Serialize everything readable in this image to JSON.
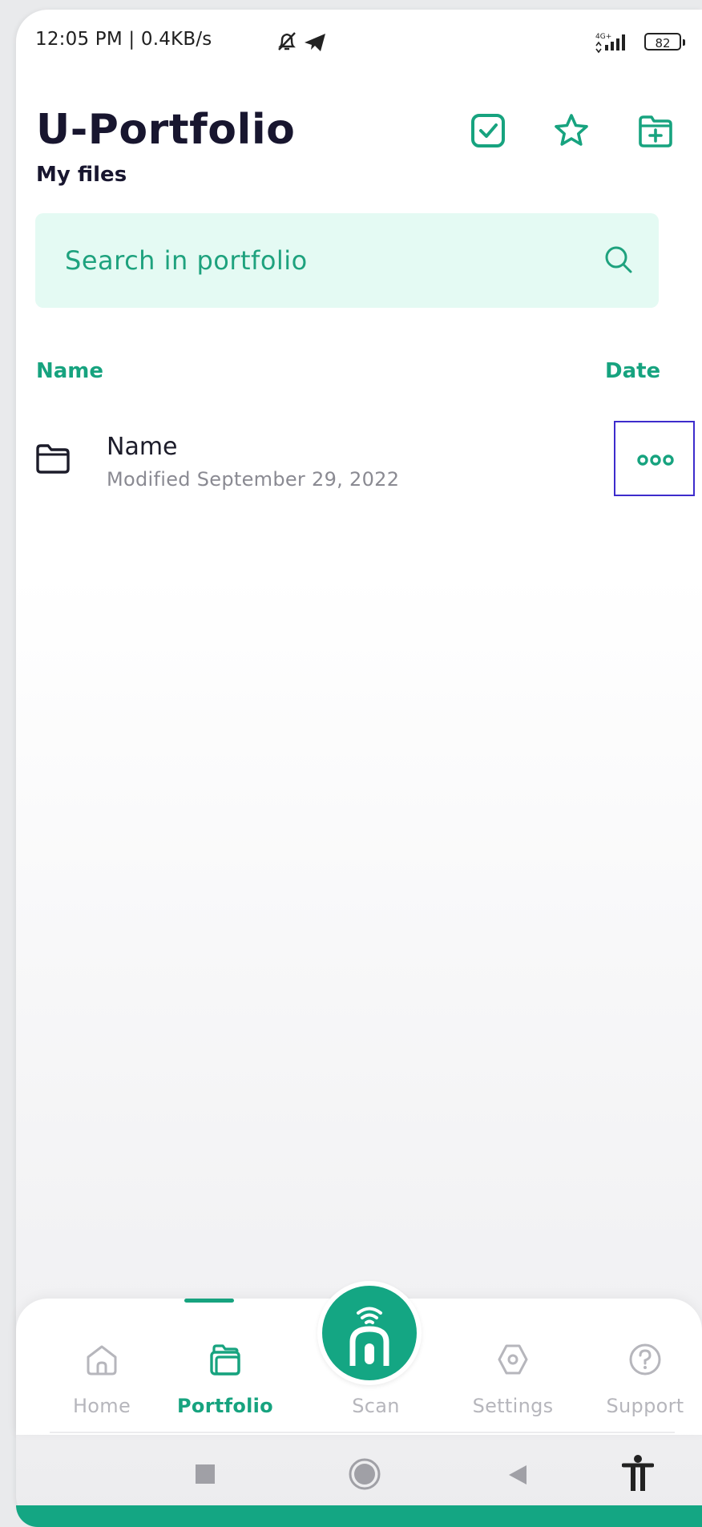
{
  "status_bar": {
    "time": "12:05 PM | 0.4KB/s",
    "network": "4G+",
    "battery": "82"
  },
  "header": {
    "title": "U-Portfolio",
    "subtitle": "My files",
    "icons": [
      "checkbox-icon",
      "star-icon",
      "folder-add-icon"
    ]
  },
  "search": {
    "placeholder": "Search in portfolio"
  },
  "columns": {
    "name": "Name",
    "date": "Date"
  },
  "files": [
    {
      "name": "Name",
      "modified": "Modified September 29, 2022",
      "icon": "folder-icon"
    }
  ],
  "bottom_nav": {
    "items": [
      {
        "label": "Home",
        "icon": "home-icon",
        "active": false
      },
      {
        "label": "Portfolio",
        "icon": "portfolio-icon",
        "active": true
      },
      {
        "label": "Scan",
        "icon": "scan-icon",
        "active": false
      },
      {
        "label": "Settings",
        "icon": "settings-icon",
        "active": false
      },
      {
        "label": "Support",
        "icon": "help-icon",
        "active": false
      }
    ]
  },
  "colors": {
    "accent": "#17a37f",
    "search_bg": "#e4faf3",
    "title": "#18162f",
    "highlight_border": "#3d2ccc"
  }
}
